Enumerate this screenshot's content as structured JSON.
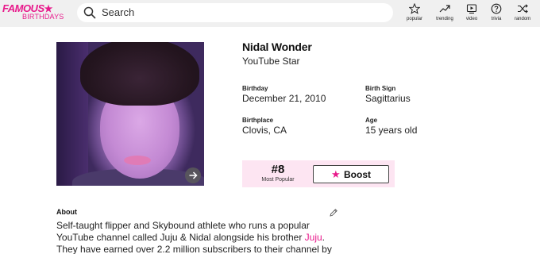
{
  "header": {
    "logo_top": "FAMOUS",
    "logo_bottom": "BIRTHDAYS",
    "search_placeholder": "Search",
    "nav": [
      {
        "label": "popular",
        "icon": "star-icon"
      },
      {
        "label": "trending",
        "icon": "trending-icon"
      },
      {
        "label": "video",
        "icon": "video-icon"
      },
      {
        "label": "trivia",
        "icon": "question-icon"
      },
      {
        "label": "random",
        "icon": "shuffle-icon"
      }
    ]
  },
  "profile": {
    "name": "Nidal Wonder",
    "role": "YouTube Star",
    "birthday_label": "Birthday",
    "birthday": "December 21, 2010",
    "sign_label": "Birth Sign",
    "sign": "Sagittarius",
    "birthplace_label": "Birthplace",
    "birthplace": "Clovis, CA",
    "age_label": "Age",
    "age": "15 years old"
  },
  "rank": {
    "number": "#8",
    "label": "Most Popular",
    "boost_label": "Boost"
  },
  "about": {
    "heading": "About",
    "line1": "Self-taught flipper and Skybound athlete who runs a popular",
    "line2_a": "YouTube channel called Juju & Nidal alongside his brother ",
    "line2_link": "Juju",
    "line2_b": ".",
    "line3": "They have earned over 2.2 million subscribers to their channel by"
  },
  "colors": {
    "brand": "#e8198b",
    "header_bg": "#f0f0f0",
    "rank_bg": "#fde5f2"
  }
}
